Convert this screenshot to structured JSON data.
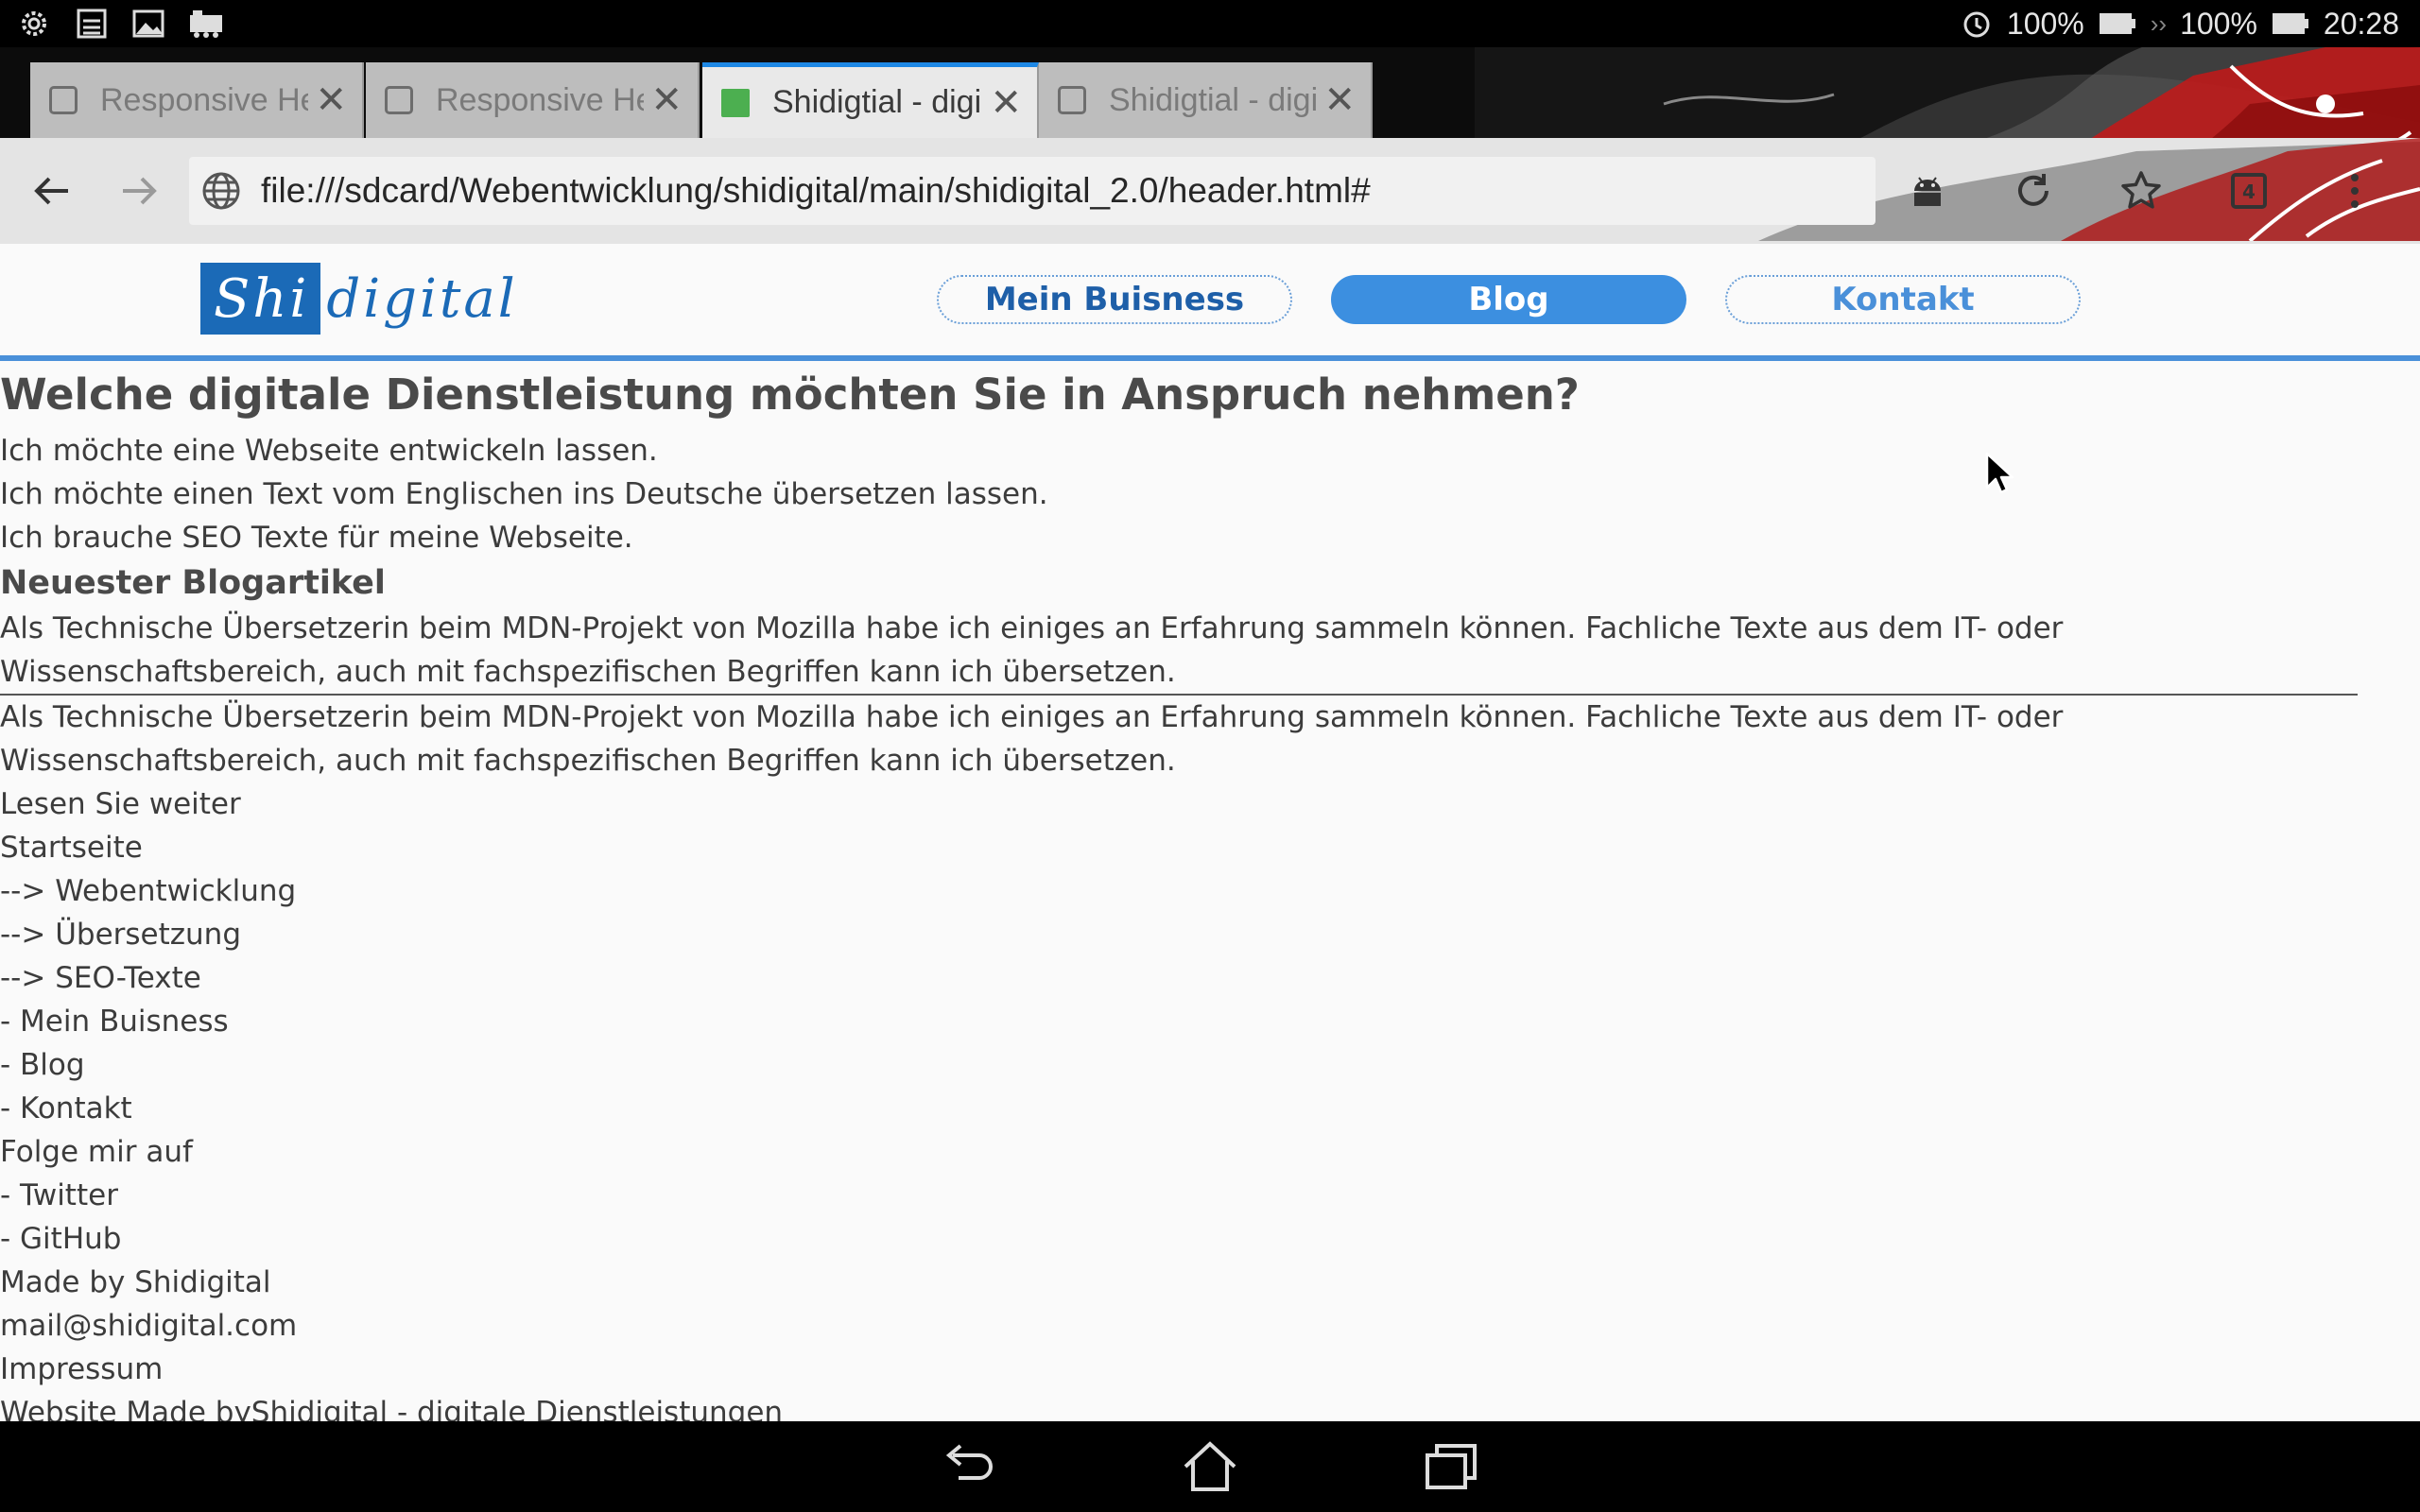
{
  "status_bar": {
    "left_icons": [
      "settings-icon",
      "download-icon",
      "image-icon",
      "train-icon"
    ],
    "alarm_icon": "alarm-icon",
    "battery_percent_1": "100%",
    "battery_percent_2": "100%",
    "time": "20:28"
  },
  "tabs": [
    {
      "title": "Responsive He",
      "active": false
    },
    {
      "title": "Responsive He",
      "active": false
    },
    {
      "title": "Shidigtial - digi",
      "active": true
    },
    {
      "title": "Shidigtial - digi",
      "active": false
    }
  ],
  "toolbar": {
    "url": "file:///sdcard/Webentwicklung/shidigital/main/shidigital_2.0/header.html#",
    "tab_count": "4"
  },
  "site": {
    "logo_part1": "Shi",
    "logo_part2": "digital",
    "nav": {
      "business": "Mein Buisness",
      "blog": "Blog",
      "contact": "Kontakt"
    }
  },
  "content": {
    "heading": "Welche digitale Dienstleistung möchten Sie in Anspruch nehmen?",
    "services": [
      "Ich möchte eine Webseite entwickeln lassen.",
      "Ich möchte einen Text vom Englischen ins Deutsche übersetzen lassen.",
      "Ich brauche SEO Texte für meine Webseite."
    ],
    "blog_heading": "Neuester Blogartikel",
    "blog_text_1": "Als Technische Übersetzerin beim MDN-Projekt von Mozilla habe ich einiges an Erfahrung sammeln können. Fachliche Texte aus dem IT- oder Wissenschaftsbereich, auch mit fachspezifischen Begriffen kann ich übersetzen.",
    "blog_text_2": "Als Technische Übersetzerin beim MDN-Projekt von Mozilla habe ich einiges an Erfahrung sammeln können. Fachliche Texte aus dem IT- oder Wissenschaftsbereich, auch mit fachspezifischen Begriffen kann ich übersetzen.",
    "read_more": "Lesen Sie weiter",
    "footer_lines": [
      "Startseite",
      "--> Webentwicklung",
      "--> Übersetzung",
      "--> SEO-Texte",
      "- Mein Buisness",
      "- Blog",
      "- Kontakt",
      "Folge mir auf",
      "- Twitter",
      "- GitHub",
      "Made by Shidigital",
      "mail@shidigital.com",
      "Impressum",
      "Website Made byShidigital - digitale Dienstleistungen"
    ]
  },
  "colors": {
    "brand_blue": "#1b6ab7",
    "nav_active": "#3c8fe0",
    "header_rule": "#4a90d9",
    "tab_indicator": "#1e88e5"
  }
}
